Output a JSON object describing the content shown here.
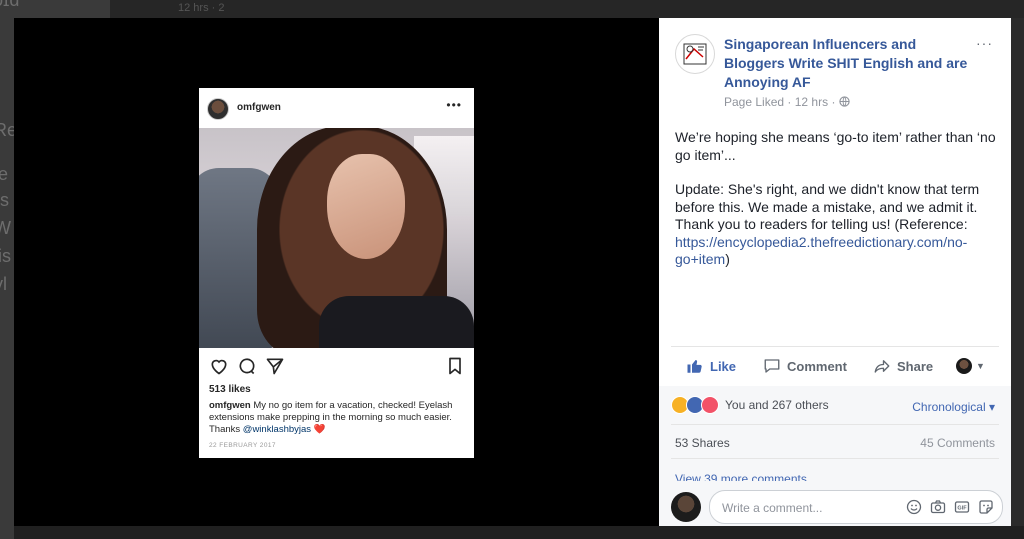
{
  "background": {
    "fragments": [
      "ia",
      "le",
      "rs",
      "W",
      "lis",
      "yl",
      "Re"
    ],
    "topbar_text": "12 hrs · 2"
  },
  "instagram": {
    "username": "omfgwen",
    "more_icon": "more-horizontal-icon",
    "likes": "513 likes",
    "caption_user": "omfgwen",
    "caption_text": "My no go item for a vacation, checked! Eyelash extensions make prepping in the morning so much easier. Thanks",
    "caption_mention": "@winklashbyjas",
    "caption_emoji": "❤️",
    "date": "22 FEBRUARY 2017",
    "icons": [
      "heart-icon",
      "comment-icon",
      "share-icon",
      "bookmark-icon"
    ]
  },
  "facebook": {
    "page_name": "Singaporean Influencers and Bloggers Write SHIT English and are Annoying AF",
    "more": "···",
    "meta_status": "Page Liked",
    "meta_time": "12 hrs",
    "meta_separator": "·",
    "body_p1": "We’re hoping she means ‘go-to item’ rather than ‘no go item’...",
    "body_p2": "Update: She's right, and we didn't know that term before this. We made a mistake, and we admit it. Thank you to readers for telling us! (Reference: ",
    "body_link": "https://encyclopedia2.thefreedictionary.com/no-go+item",
    "body_p2_end": ")",
    "actions": {
      "like": "Like",
      "comment": "Comment",
      "share": "Share"
    },
    "reactions_text": "You and 267 others",
    "sort_label": "Chronological ▾",
    "shares": "53 Shares",
    "comments_count": "45 Comments",
    "view_more": "View 39 more comments",
    "compose_placeholder": "Write a comment...",
    "colors": {
      "link": "#365899",
      "accent": "#4267b2",
      "text": "#1d2129",
      "muted": "#90949c"
    }
  }
}
